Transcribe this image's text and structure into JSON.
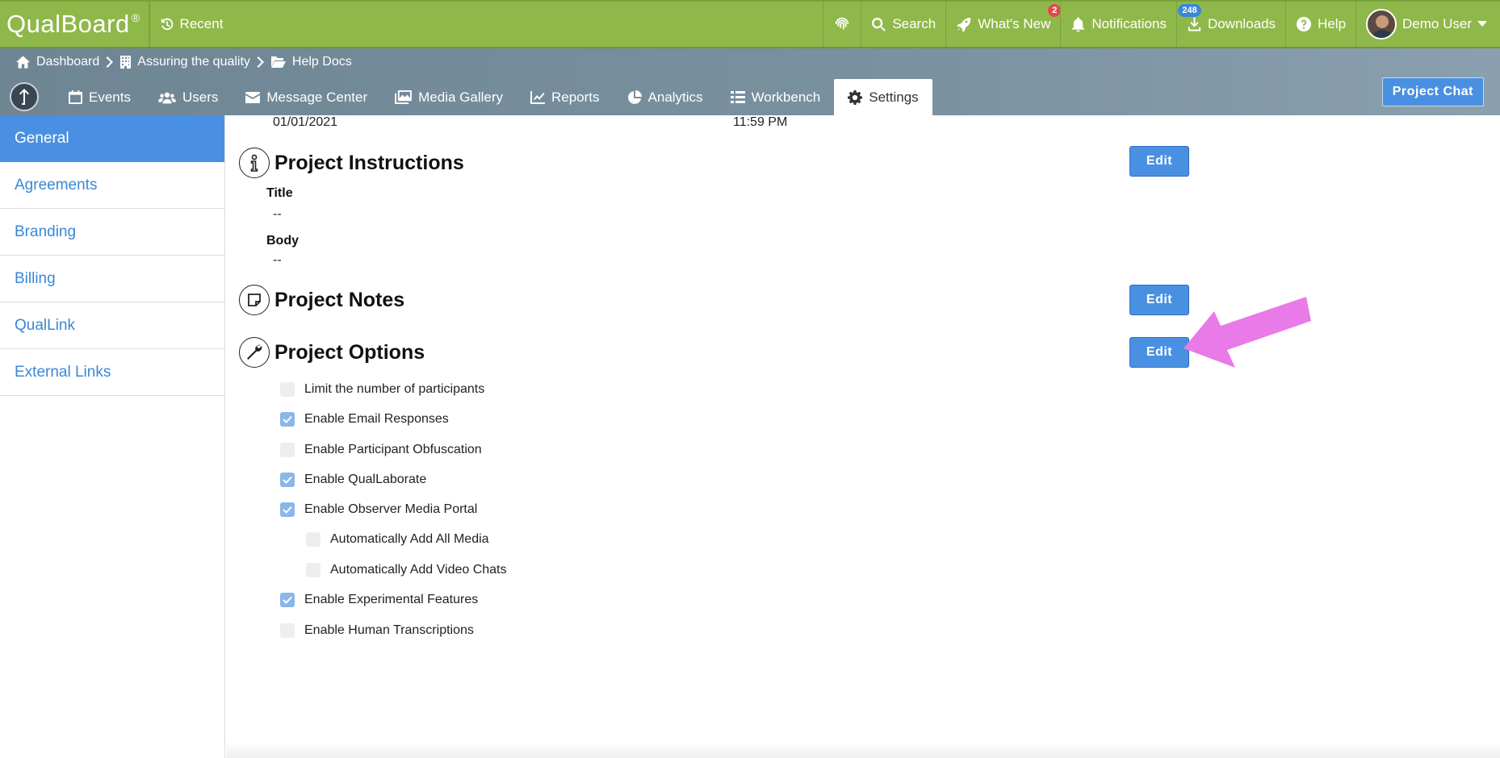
{
  "topbar": {
    "logo": "QualBoard",
    "logo_mark": "®",
    "recent": "Recent",
    "search": "Search",
    "whats_new": "What's New",
    "whats_new_badge": "2",
    "notifications": "Notifications",
    "notifications_badge": "248",
    "downloads": "Downloads",
    "help": "Help",
    "user": "Demo User"
  },
  "breadcrumb": [
    "Dashboard",
    "Assuring the quality",
    "Help Docs"
  ],
  "tabs": [
    "Events",
    "Users",
    "Message Center",
    "Media Gallery",
    "Reports",
    "Analytics",
    "Workbench",
    "Settings"
  ],
  "project_chat": "Project Chat",
  "sidebar": [
    "General",
    "Agreements",
    "Branding",
    "Billing",
    "QualLink",
    "External Links"
  ],
  "main": {
    "date_start": "01/01/2021",
    "time_end": "11:59 PM",
    "instructions": {
      "title": "Project Instructions",
      "edit": "Edit",
      "title_label": "Title",
      "title_value": "--",
      "body_label": "Body",
      "body_value": "--"
    },
    "notes": {
      "title": "Project Notes",
      "edit": "Edit"
    },
    "options": {
      "title": "Project Options",
      "edit": "Edit",
      "items": [
        {
          "label": "Limit the number of participants",
          "checked": false
        },
        {
          "label": "Enable Email Responses",
          "checked": true
        },
        {
          "label": "Enable Participant Obfuscation",
          "checked": false
        },
        {
          "label": "Enable QualLaborate",
          "checked": true
        },
        {
          "label": "Enable Observer Media Portal",
          "checked": true
        },
        {
          "label": "Automatically Add All Media",
          "checked": false
        },
        {
          "label": "Automatically Add Video Chats",
          "checked": false
        },
        {
          "label": "Enable Experimental Features",
          "checked": true
        },
        {
          "label": "Enable Human Transcriptions",
          "checked": false
        }
      ]
    }
  },
  "colors": {
    "topbar": "#8fb84a",
    "navbar": "#7a91a0",
    "accent": "#4a90e2",
    "arrow": "#e87be8"
  }
}
